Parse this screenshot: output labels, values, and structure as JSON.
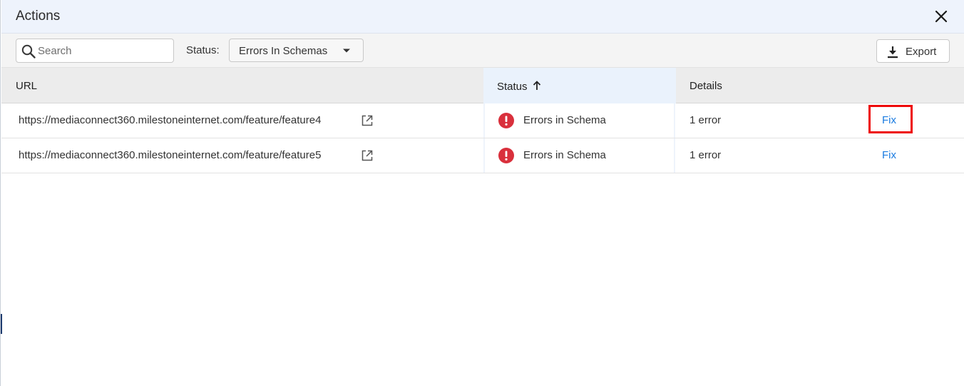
{
  "dialog": {
    "title": "Actions",
    "close_icon": "close-icon"
  },
  "toolbar": {
    "search_placeholder": "Search",
    "search_value": "",
    "search_icon": "search-icon",
    "status_label": "Status:",
    "status_selected": "Errors In Schemas",
    "status_caret_icon": "caret-down-icon",
    "export_label": "Export",
    "export_icon": "download-icon"
  },
  "table": {
    "columns": [
      {
        "label": "URL"
      },
      {
        "label": "Status",
        "sorted": "ascending",
        "sort_icon": "arrow-up-icon"
      },
      {
        "label": "Details"
      }
    ],
    "rows": [
      {
        "url": "https://mediaconnect360.milestoneinternet.com/feature/feature4",
        "link_icon": "external-link-icon",
        "status_icon": "error-icon",
        "status": "Errors in Schema",
        "details": "1 error",
        "action": "Fix",
        "highlighted": true
      },
      {
        "url": "https://mediaconnect360.milestoneinternet.com/feature/feature5",
        "link_icon": "external-link-icon",
        "status_icon": "error-icon",
        "status": "Errors in Schema",
        "details": "1 error",
        "action": "Fix",
        "highlighted": false
      }
    ]
  },
  "colors": {
    "header_bg": "#eef3fc",
    "link": "#1a7be0",
    "error": "#d9303c",
    "highlight": "#ee0a0a"
  }
}
